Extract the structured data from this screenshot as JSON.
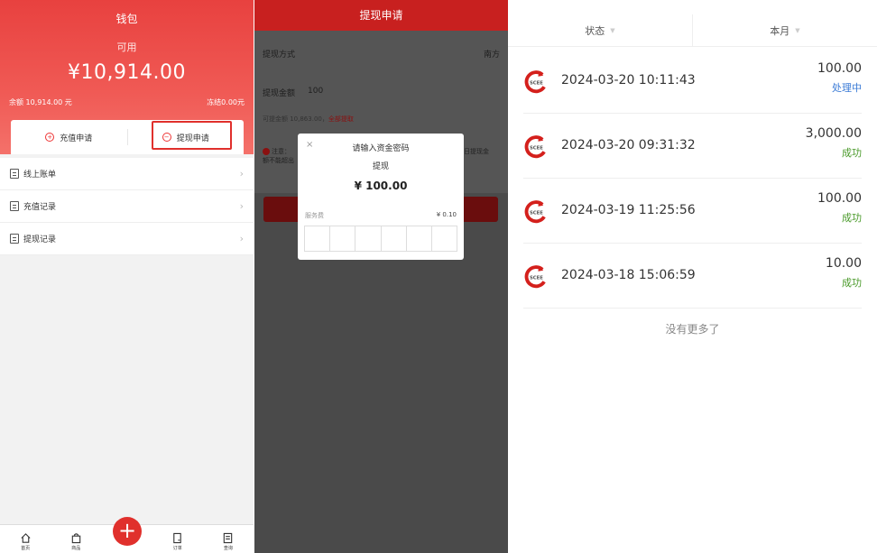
{
  "wallet": {
    "title": "钱包",
    "available_label": "可用",
    "available_amount": "¥10,914.00",
    "balance": "余额 10,914.00 元",
    "frozen": "冻结0.00元",
    "recharge_btn": "充值申请",
    "withdraw_btn": "提现申请",
    "menu": [
      {
        "label": "线上账单"
      },
      {
        "label": "充值记录"
      },
      {
        "label": "提现记录"
      }
    ],
    "nav": [
      {
        "label": "首页"
      },
      {
        "label": "商品"
      },
      {
        "label": "订单"
      },
      {
        "label": "查询"
      }
    ],
    "plus": "+"
  },
  "withdraw": {
    "title": "提现申请",
    "method_label": "提现方式",
    "method_value": "南方",
    "amount_label": "提现金额",
    "amount_value": "100",
    "available_text": "可提金额 10,863.00，",
    "withdraw_all": "全部提取",
    "note_left": "注意：\n额不能超出",
    "note_right": "日提现金",
    "dialog": {
      "close": "×",
      "title": "请输入资金密码",
      "subtitle": "提现",
      "amount": "¥ 100.00",
      "fee_label": "服务费",
      "fee_value": "¥ 0.10"
    }
  },
  "records": {
    "tab_status": "状态",
    "tab_month": "本月",
    "items": [
      {
        "time": "2024-03-20 10:11:43",
        "amount": "100.00",
        "status": "处理中",
        "status_color": "#3b7bd6"
      },
      {
        "time": "2024-03-20 09:31:32",
        "amount": "3,000.00",
        "status": "成功",
        "status_color": "#4a9a2a"
      },
      {
        "time": "2024-03-19 11:25:56",
        "amount": "100.00",
        "status": "成功",
        "status_color": "#4a9a2a"
      },
      {
        "time": "2024-03-18 15:06:59",
        "amount": "10.00",
        "status": "成功",
        "status_color": "#4a9a2a"
      }
    ],
    "no_more": "没有更多了",
    "logo_text": "SCEE"
  },
  "colors": {
    "accent": "#e0302c",
    "header_red": "#c8201f"
  }
}
